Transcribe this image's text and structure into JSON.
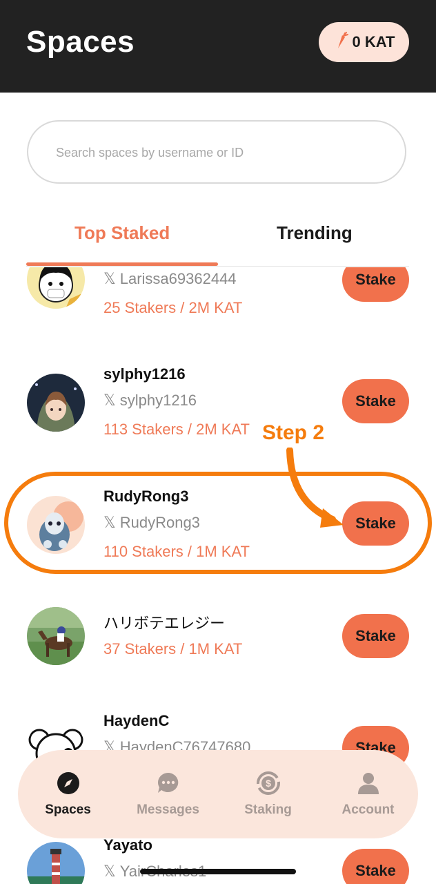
{
  "header": {
    "title": "Spaces",
    "balance": "0 KAT"
  },
  "search": {
    "placeholder": "Search spaces by username or ID",
    "value": ""
  },
  "tabs": [
    {
      "label": "Top Staked",
      "active": true
    },
    {
      "label": "Trending",
      "active": false
    }
  ],
  "spaces": [
    {
      "name": "",
      "handle": "Larissa69362444",
      "stats": "25 Stakers / 2M KAT",
      "button": "Stake"
    },
    {
      "name": "sylphy1216",
      "handle": "sylphy1216",
      "stats": "113 Stakers / 2M KAT",
      "button": "Stake"
    },
    {
      "name": "RudyRong3",
      "handle": "RudyRong3",
      "stats": "110 Stakers / 1M KAT",
      "button": "Stake"
    },
    {
      "name": "ハリボテエレジー",
      "handle": "",
      "stats": "37 Stakers / 1M KAT",
      "button": "Stake"
    },
    {
      "name": "HaydenC",
      "handle": "HaydenC76747680",
      "stats": "",
      "button": "Stake"
    },
    {
      "name": "Yayato",
      "handle": "YairCharles1",
      "stats": "",
      "button": "Stake"
    }
  ],
  "annotation": {
    "label": "Step 2",
    "color": "#f57c0d"
  },
  "nav": [
    {
      "label": "Spaces",
      "icon": "compass-icon",
      "active": true
    },
    {
      "label": "Messages",
      "icon": "chat-bubble-icon",
      "active": false
    },
    {
      "label": "Staking",
      "icon": "dollar-coin-icon",
      "active": false
    },
    {
      "label": "Account",
      "icon": "person-icon",
      "active": false
    }
  ],
  "colors": {
    "accent": "#ef7a57",
    "button": "#f1714c",
    "header_bg": "#222222",
    "nav_bg": "#fbe6dc"
  }
}
